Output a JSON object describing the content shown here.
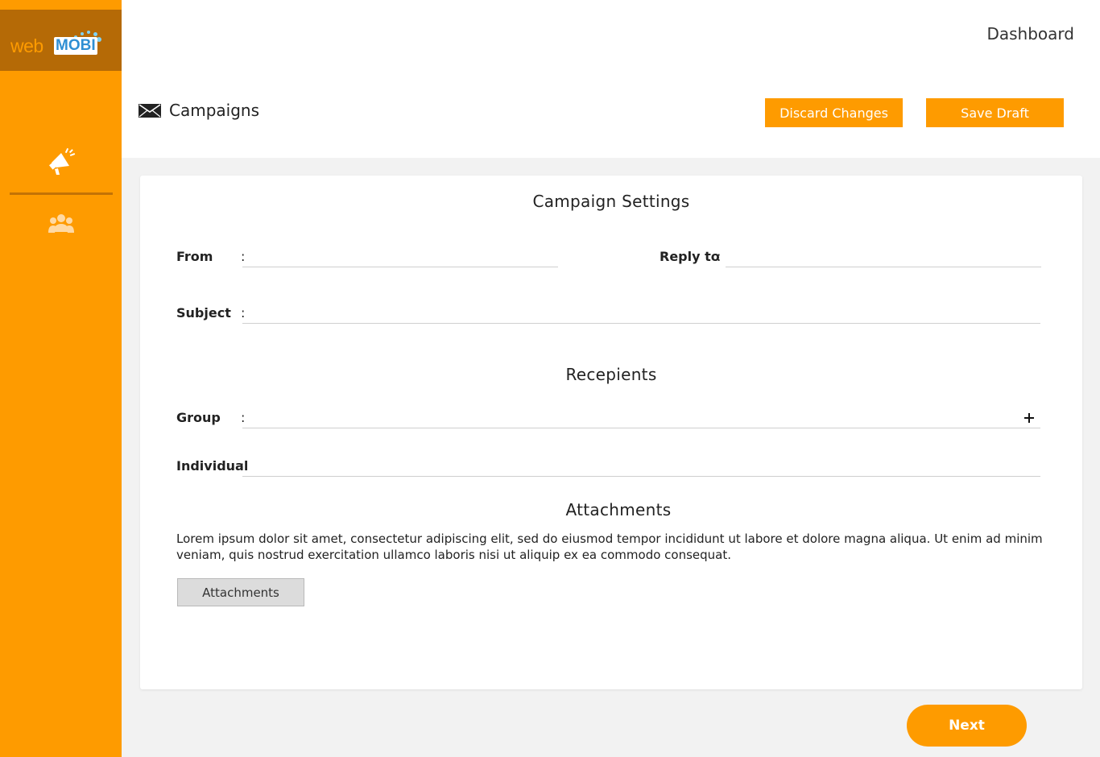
{
  "brand": {
    "logo_web": "web",
    "logo_mobi": "MOBI",
    "accent_color": "#fe9b00",
    "logo_bg_color": "#b56a06"
  },
  "sidebar": {
    "items": [
      {
        "icon": "megaphone-icon"
      },
      {
        "icon": "users-icon"
      }
    ]
  },
  "header": {
    "dashboard_label": "Dashboard",
    "page_title": "Campaigns",
    "page_icon": "envelope-icon",
    "discard_label": "Discard Changes",
    "save_draft_label": "Save Draft"
  },
  "settings": {
    "title": "Campaign Settings",
    "from_label": "From",
    "reply_to_label": "Reply to",
    "subject_label": "Subject",
    "colon": ":"
  },
  "recipients": {
    "title": "Recepients",
    "group_label": "Group",
    "individual_label": "Individual",
    "add_icon": "plus-icon"
  },
  "attachments": {
    "title": "Attachments",
    "description": "Lorem ipsum dolor sit amet, consectetur adipiscing elit, sed do eiusmod tempor incididunt ut labore et dolore magna aliqua. Ut enim ad minim veniam, quis nostrud exercitation ullamco laboris nisi ut aliquip ex ea commodo consequat.",
    "button_label": "Attachments"
  },
  "footer": {
    "next_label": "Next"
  }
}
